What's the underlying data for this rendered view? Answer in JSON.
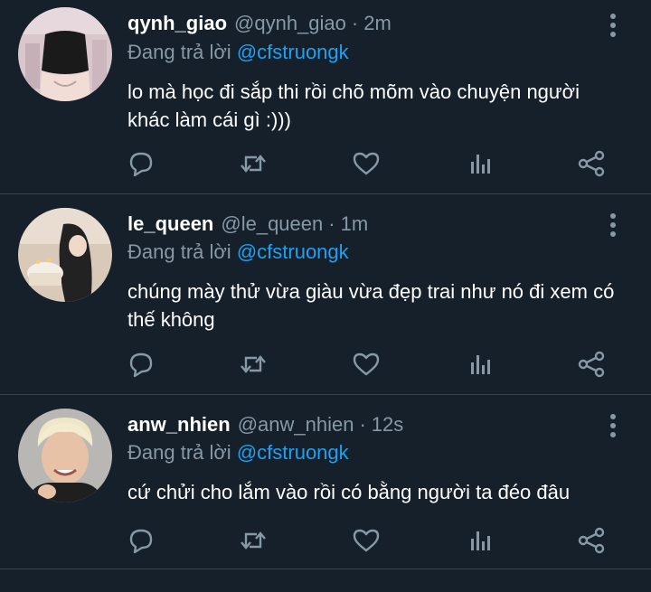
{
  "tweets": [
    {
      "name": "qynh_giao",
      "handle": "@qynh_giao",
      "time": "2m",
      "reply_prefix": "Đang trả lời",
      "reply_to": "@cfstruongk",
      "text": "lo mà học đi sắp thi rồi chõ mõm vào chuyện người khác làm cái gì :)))"
    },
    {
      "name": "le_queen",
      "handle": "@le_queen",
      "time": "1m",
      "reply_prefix": "Đang trả lời",
      "reply_to": "@cfstruongk",
      "text": "chúng mày thử vừa giàu vừa đẹp trai như nó đi xem có thế không"
    },
    {
      "name": "anw_nhien",
      "handle": "@anw_nhien",
      "time": "12s",
      "reply_prefix": "Đang trả lời",
      "reply_to": "@cfstruongk",
      "text": "cứ chửi cho lắm vào rồi có bằng người ta đéo đâu"
    }
  ],
  "separator": "·",
  "icons": [
    "reply-icon",
    "retweet-icon",
    "like-icon",
    "analytics-icon",
    "share-icon",
    "more-options-icon"
  ],
  "colors": {
    "background": "#15202b",
    "muted": "#8899a6",
    "accent": "#1da1f2",
    "divider": "#38444d"
  }
}
